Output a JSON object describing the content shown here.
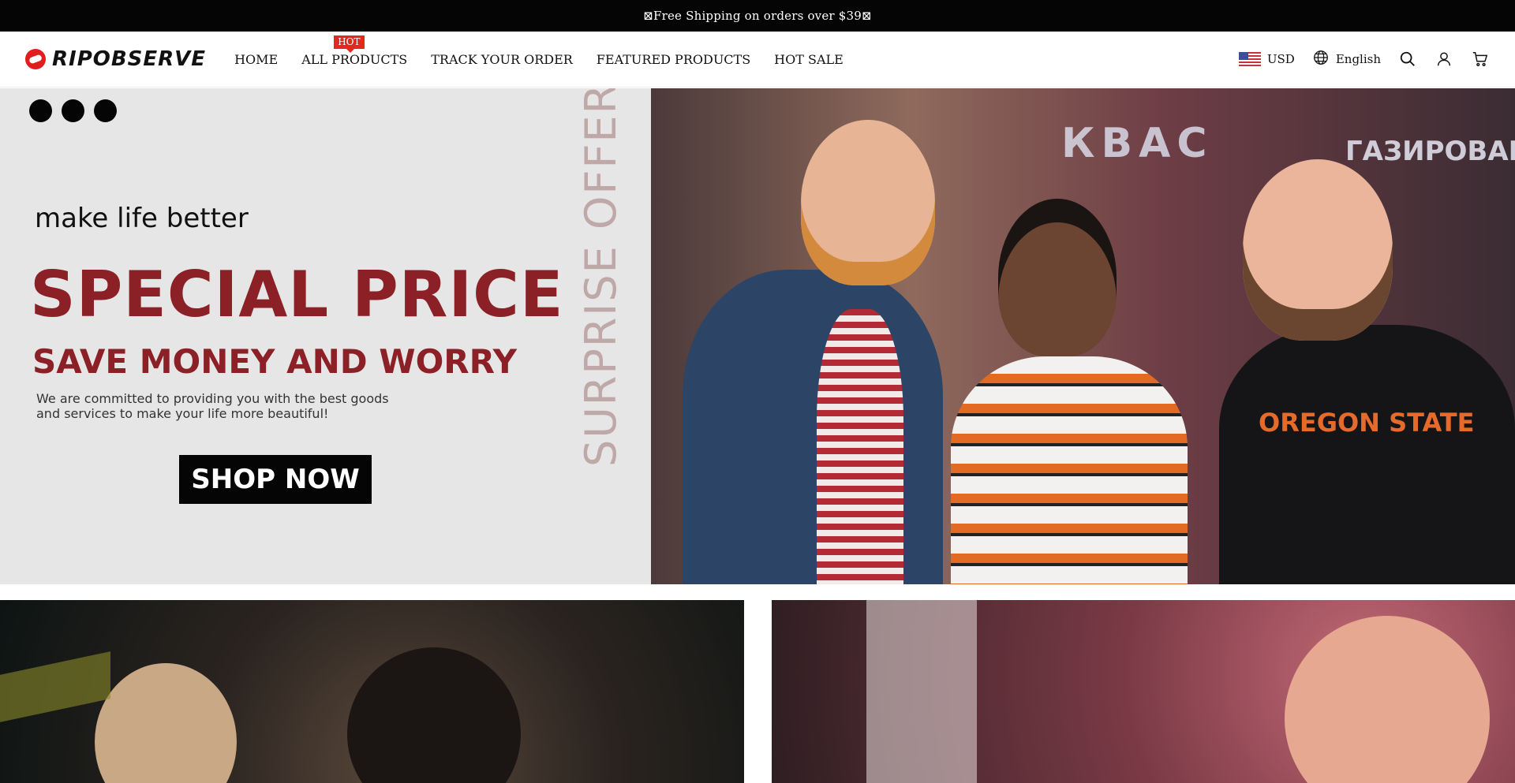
{
  "announcement": {
    "text": "⊠Free Shipping on orders over $39⊠"
  },
  "header": {
    "logo_text": "RIPOBSERVE",
    "nav": [
      {
        "label": "HOME"
      },
      {
        "label": "ALL PRODUCTS",
        "badge": "HOT"
      },
      {
        "label": "TRACK YOUR ORDER"
      },
      {
        "label": "FEATURED PRODUCTS"
      },
      {
        "label": "HOT SALE"
      }
    ],
    "currency": "USD",
    "language": "English",
    "icons": [
      "globe-icon",
      "search-icon",
      "account-icon",
      "cart-icon"
    ]
  },
  "hero": {
    "tagline": "make life better",
    "title": "SPECIAL PRICE",
    "subtitle": "SAVE MONEY AND WORRY",
    "description": "We are committed to providing you with the best goods and services to make your life more beautiful!",
    "cta": "SHOP NOW",
    "vertical_text": "SURPRISE OFFER",
    "photo_signs": [
      "КВАС",
      "ГАЗИРОВАННАЯ"
    ],
    "shirt_text": "OREGON STATE",
    "slider_dots": 3
  },
  "colors": {
    "accent": "#8b2026",
    "badge": "#e02a1f",
    "announcement_bg": "#050505",
    "hero_bg": "#e7e6e6"
  }
}
